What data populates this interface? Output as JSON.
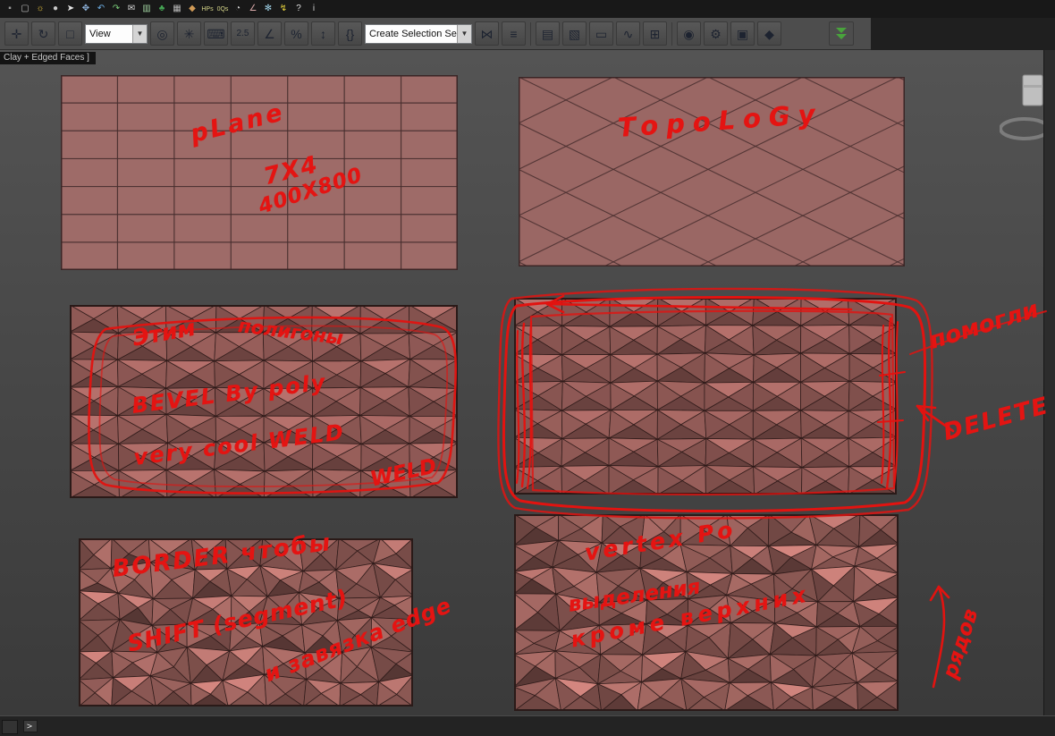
{
  "toolbar_top": {
    "icons": [
      {
        "name": "app-menu-icon",
        "glyph": "▪",
        "color": "#9a9a9a"
      },
      {
        "name": "new-scene-icon",
        "glyph": "▢",
        "color": "#bdbdbd"
      },
      {
        "name": "sun-icon",
        "glyph": "☼",
        "color": "#e6c23c"
      },
      {
        "name": "sphere-icon",
        "glyph": "●",
        "color": "#c9c9c9"
      },
      {
        "name": "select-cursor-icon",
        "glyph": "➤",
        "color": "#e8e8e8"
      },
      {
        "name": "pan-hand-icon",
        "glyph": "✥",
        "color": "#8fb4dd"
      },
      {
        "name": "undo-icon",
        "glyph": "↶",
        "color": "#6fb0e6"
      },
      {
        "name": "redo-icon",
        "glyph": "↷",
        "color": "#79cc79"
      },
      {
        "name": "envelope-icon",
        "glyph": "✉",
        "color": "#d8d8d8"
      },
      {
        "name": "chart-icon",
        "glyph": "▥",
        "color": "#9fcf9f"
      },
      {
        "name": "plant-icon",
        "glyph": "♣",
        "color": "#45a554"
      },
      {
        "name": "grid-box-icon",
        "glyph": "▦",
        "color": "#b5b5b5"
      },
      {
        "name": "teapot-icon",
        "glyph": "◆",
        "color": "#d09a56"
      },
      {
        "name": "hps-icon",
        "glyph": "HPs",
        "color": "#d6d68a"
      },
      {
        "name": "oqs-icon",
        "glyph": "0Qs",
        "color": "#d6d68a"
      },
      {
        "name": "clock-icon",
        "glyph": "◔",
        "color": "#cfcfcf"
      },
      {
        "name": "angle-icon",
        "glyph": "∠",
        "color": "#d8a8a8"
      },
      {
        "name": "snowflake-icon",
        "glyph": "✻",
        "color": "#9fd2e8"
      },
      {
        "name": "lightning-icon",
        "glyph": "↯",
        "color": "#e6d23c"
      },
      {
        "name": "help-icon",
        "glyph": "?",
        "color": "#e0e0e0"
      },
      {
        "name": "info-icon",
        "glyph": "i",
        "color": "#cfcfcf"
      }
    ]
  },
  "toolbar_main": {
    "select_tools": [
      {
        "name": "select-and-move-icon",
        "glyph": "✛"
      },
      {
        "name": "select-and-rotate-icon",
        "glyph": "↻"
      },
      {
        "name": "select-and-scale-icon",
        "glyph": "□"
      }
    ],
    "ref_coord_value": "View",
    "dropdown_arrow": "▼",
    "pivot_tools": [
      {
        "name": "use-pivot-center-icon",
        "glyph": "◎"
      },
      {
        "name": "select-and-manipulate-icon",
        "glyph": "✳"
      },
      {
        "name": "keyboard-override-icon",
        "glyph": "⌨"
      }
    ],
    "snap_tools": [
      {
        "name": "snaps-toggle-icon",
        "glyph": "2.5"
      },
      {
        "name": "angle-snap-icon",
        "glyph": "∠"
      },
      {
        "name": "percent-snap-icon",
        "glyph": "%"
      },
      {
        "name": "spinner-snap-icon",
        "glyph": "↕"
      }
    ],
    "named_sets_glyph": "{}",
    "selection_set_value": "Create Selection Se",
    "mirror_align": [
      {
        "name": "mirror-icon",
        "glyph": "⋈"
      },
      {
        "name": "align-icon",
        "glyph": "≡"
      }
    ],
    "editors": [
      {
        "name": "scene-explorer-icon",
        "glyph": "▤"
      },
      {
        "name": "layer-manager-icon",
        "glyph": "▧"
      },
      {
        "name": "ribbon-icon",
        "glyph": "▭"
      },
      {
        "name": "curve-editor-icon",
        "glyph": "∿"
      },
      {
        "name": "schematic-view-icon",
        "glyph": "⊞"
      }
    ],
    "render_tools": [
      {
        "name": "material-editor-icon",
        "glyph": "◉"
      },
      {
        "name": "render-setup-icon",
        "glyph": "⚙"
      },
      {
        "name": "rendered-frame-icon",
        "glyph": "▣"
      },
      {
        "name": "render-production-icon",
        "glyph": "◆"
      }
    ]
  },
  "viewport": {
    "label": "Clay + Edged Faces ]"
  },
  "annotations": {
    "plane_label": "pLane",
    "plane_grid": "7X4",
    "plane_size": "400X800",
    "topology": "TopoLoGy",
    "note1a": "Этим",
    "note1b": "полигоны",
    "note1c": "BEVEL  By  poly",
    "note1d": "very cool  WELD",
    "note1e": "WELD",
    "helped": "помогли",
    "delete_note": "DELETE",
    "note2a": "BORDER  чтобы",
    "note2b": "SHIFT  (segment)",
    "note2c": "и завязка edge",
    "note3a": "vertex  Po",
    "note3b": "выделения",
    "note3c": "кроме  верхних",
    "note3d": "рядов"
  },
  "statusbar": {
    "mini_listener_prompt": ">"
  }
}
